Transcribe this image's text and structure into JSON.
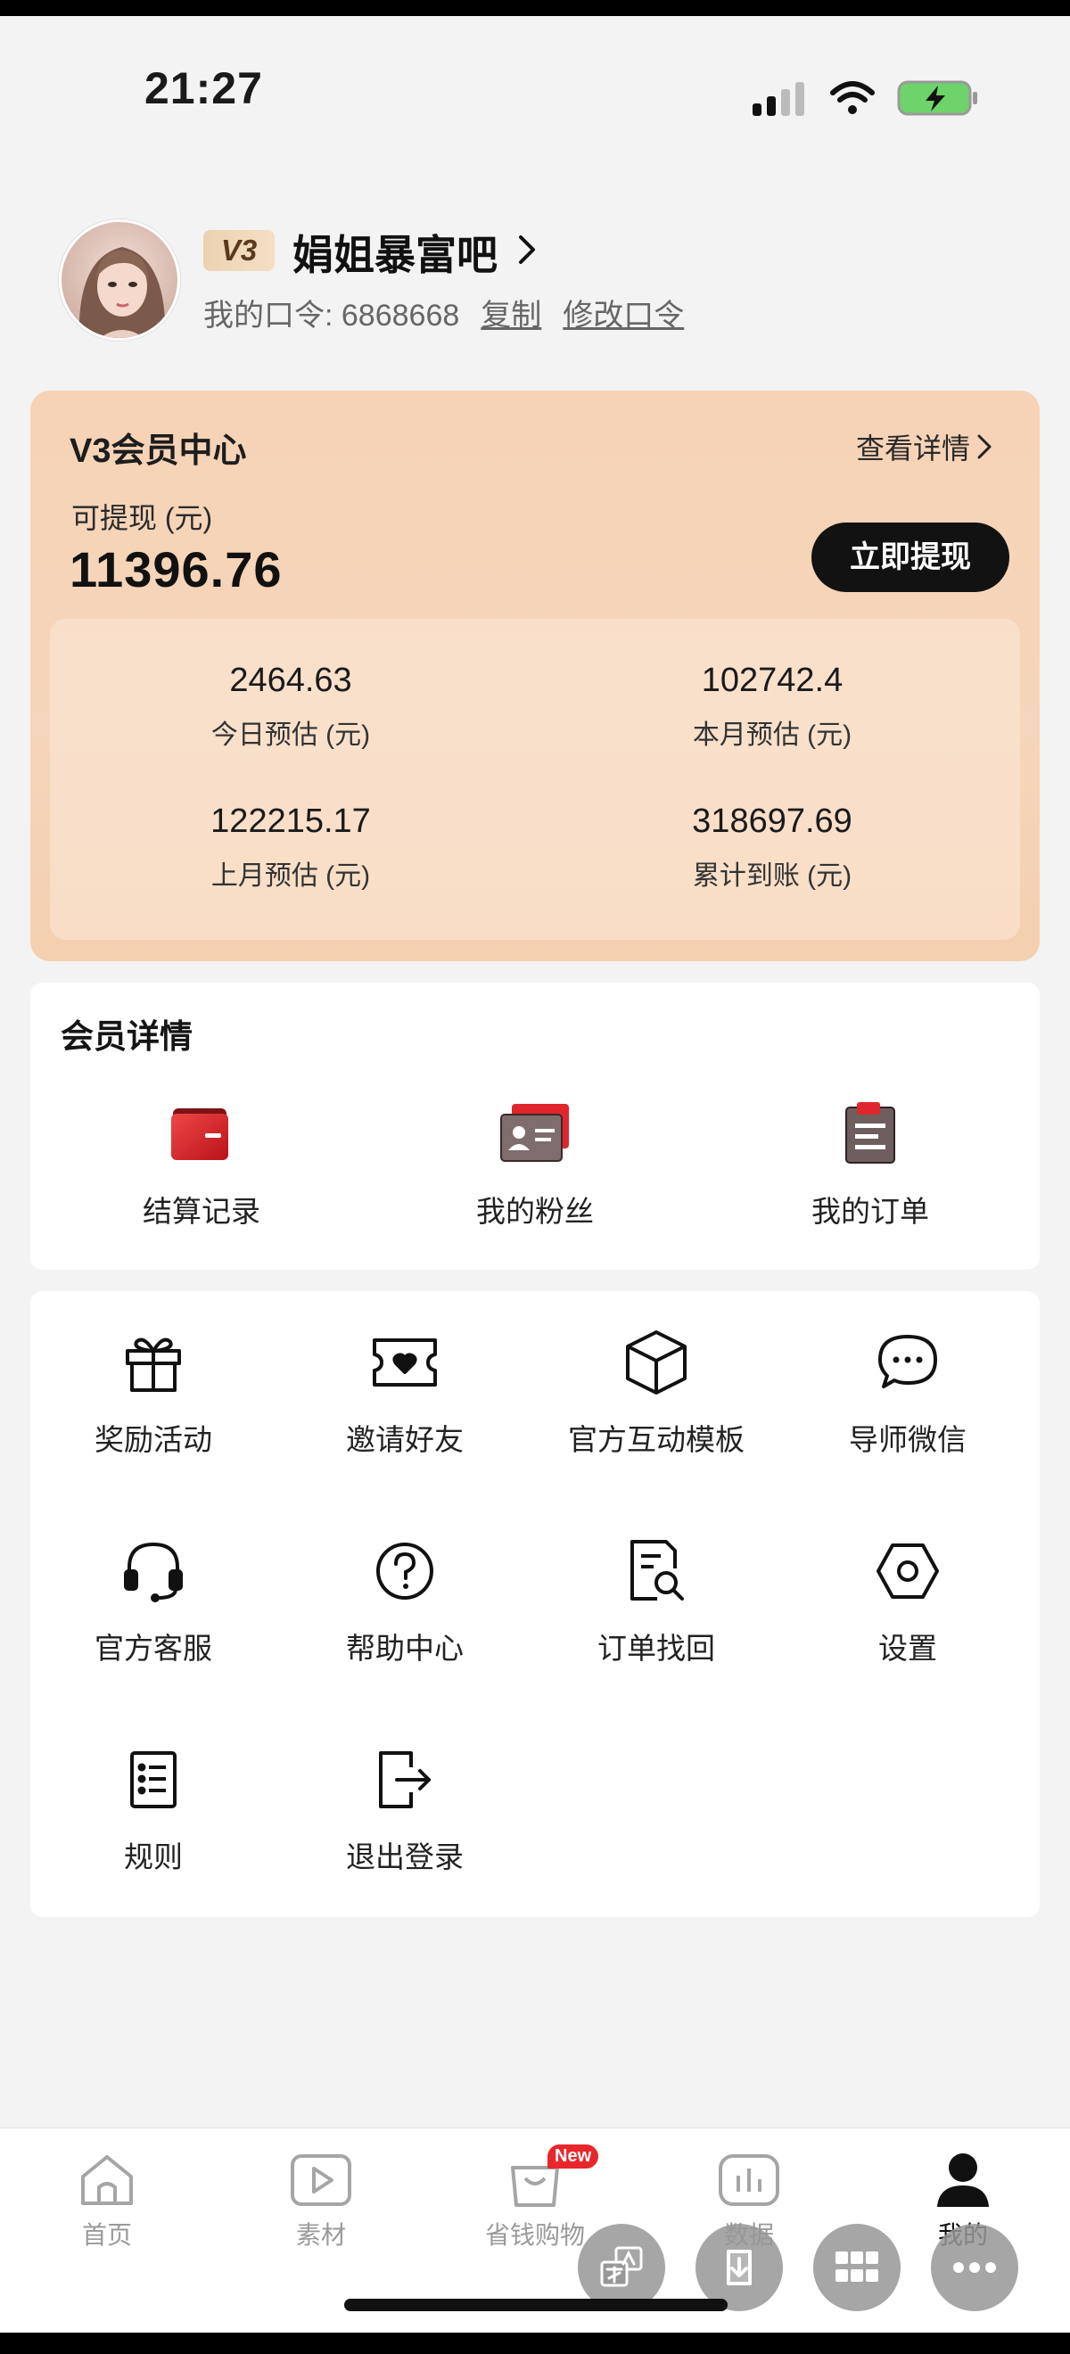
{
  "status_bar": {
    "time": "21:27"
  },
  "profile": {
    "level": "V3",
    "name": "娟姐暴富吧",
    "code_label": "我的口令: 6868668",
    "copy": "复制",
    "edit": "修改口令"
  },
  "vip_card": {
    "title": "V3会员中心",
    "detail": "查看详情",
    "withdraw_label": "可提现 (元)",
    "withdraw_value": "11396.76",
    "withdraw_button": "立即提现",
    "stats": [
      {
        "value": "2464.63",
        "label": "今日预估 (元)"
      },
      {
        "value": "102742.4",
        "label": "本月预估 (元)"
      },
      {
        "value": "122215.17",
        "label": "上月预估 (元)"
      },
      {
        "value": "318697.69",
        "label": "累计到账 (元)"
      }
    ]
  },
  "member_details": {
    "title": "会员详情",
    "items": [
      {
        "label": "结算记录",
        "icon": "wallet-icon"
      },
      {
        "label": "我的粉丝",
        "icon": "id-card-icon"
      },
      {
        "label": "我的订单",
        "icon": "clipboard-icon"
      }
    ]
  },
  "tools": {
    "items": [
      {
        "label": "奖励活动",
        "icon": "gift-icon"
      },
      {
        "label": "邀请好友",
        "icon": "ticket-heart-icon"
      },
      {
        "label": "官方互动模板",
        "icon": "cube-icon"
      },
      {
        "label": "导师微信",
        "icon": "chat-bubble-icon"
      },
      {
        "label": "官方客服",
        "icon": "headset-icon"
      },
      {
        "label": "帮助中心",
        "icon": "help-icon"
      },
      {
        "label": "订单找回",
        "icon": "document-search-icon"
      },
      {
        "label": "设置",
        "icon": "settings-icon"
      },
      {
        "label": "规则",
        "icon": "list-icon"
      },
      {
        "label": "退出登录",
        "icon": "logout-icon"
      }
    ]
  },
  "tabbar": {
    "items": [
      {
        "label": "首页",
        "icon": "home-icon"
      },
      {
        "label": "素材",
        "icon": "play-icon"
      },
      {
        "label": "省钱购物",
        "icon": "shopping-bag-icon",
        "badge": "New"
      },
      {
        "label": "数据",
        "icon": "bar-chart-icon"
      },
      {
        "label": "我的",
        "icon": "user-icon"
      }
    ]
  },
  "colors": {
    "accent_red": "#d8232a",
    "card_bg": "#f6d3b6",
    "button_dark": "#121212"
  }
}
